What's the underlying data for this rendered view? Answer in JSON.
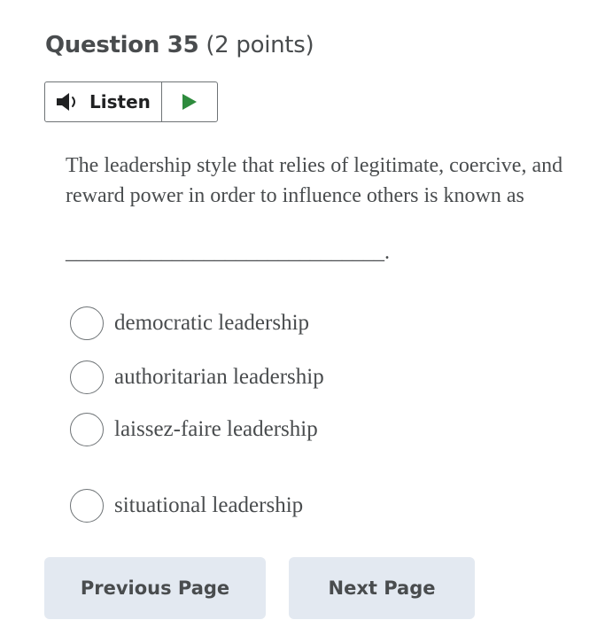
{
  "question": {
    "number_label": "Question 35",
    "points_label": "(2 points)"
  },
  "listen": {
    "label": "Listen",
    "speaker_icon": "speaker-icon",
    "play_icon": "play-icon",
    "play_color": "#2e8b3d"
  },
  "prompt": {
    "text": "The leadership style that relies of legitimate, coercive, and reward power in order to influence others is known as",
    "blank": "______________________________."
  },
  "choices": [
    {
      "label": "democratic leadership",
      "selected": false
    },
    {
      "label": "authoritarian leadership",
      "selected": false
    },
    {
      "label": "laissez-faire leadership",
      "selected": false
    },
    {
      "label": "situational leadership",
      "selected": false
    }
  ],
  "navigation": {
    "previous_label": "Previous Page",
    "next_label": "Next Page"
  }
}
